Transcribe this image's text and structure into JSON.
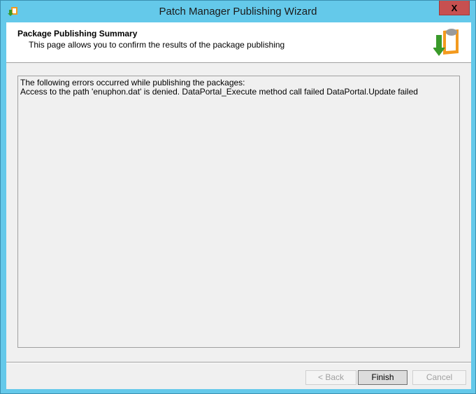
{
  "window": {
    "title": "Patch Manager Publishing Wizard",
    "close_label": "X"
  },
  "header": {
    "title": "Package Publishing Summary",
    "subtitle": "This page allows you to confirm the results of the package publishing"
  },
  "results": {
    "lines": [
      "The following errors occurred while publishing the packages:",
      "Access to the path 'enuphon.dat' is denied. DataPortal_Execute method call failed DataPortal.Update failed"
    ]
  },
  "buttons": {
    "back": "< Back",
    "finish": "Finish",
    "cancel": "Cancel"
  }
}
